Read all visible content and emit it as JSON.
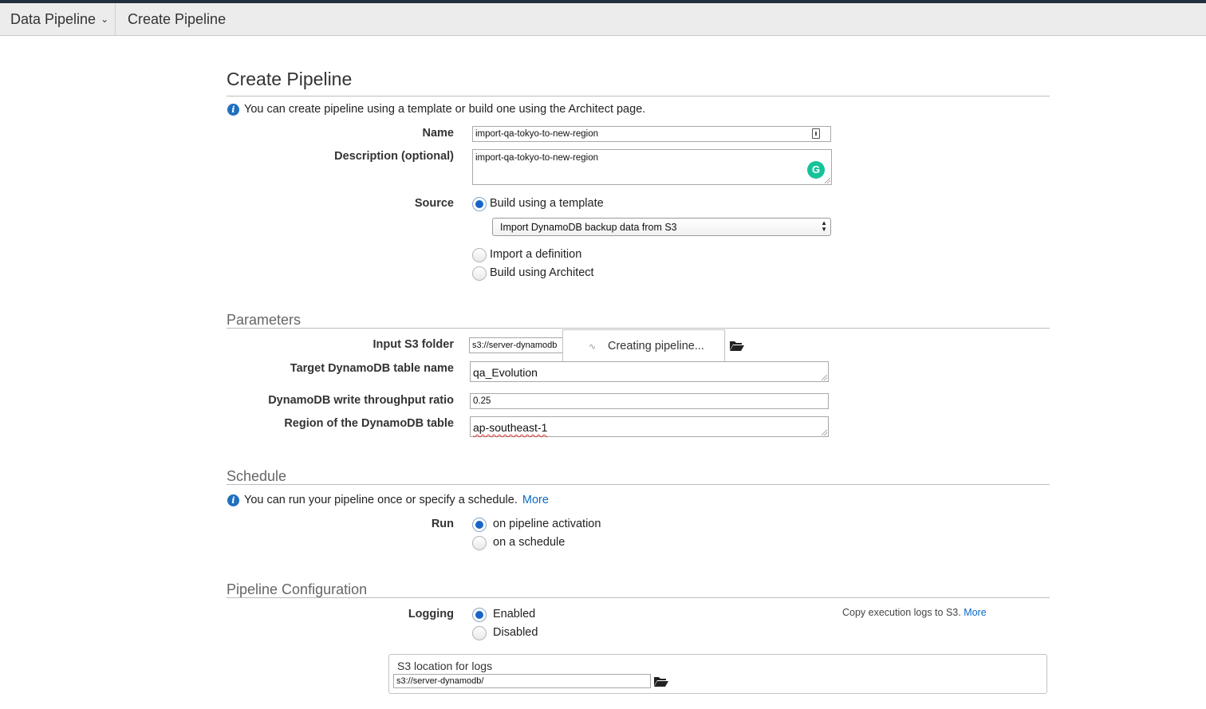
{
  "nav": {
    "service_label": "Data Pipeline",
    "page_label": "Create Pipeline"
  },
  "page": {
    "title": "Create Pipeline",
    "intro": "You can create pipeline using a template or build one using the Architect page."
  },
  "form": {
    "name_label": "Name",
    "name_value": "import-qa-tokyo-to-new-region",
    "description_label": "Description (optional)",
    "description_value": "import-qa-tokyo-to-new-region",
    "source_label": "Source",
    "source_options": {
      "template": "Build using a template",
      "import": "Import a definition",
      "architect": "Build using Architect"
    },
    "source_selected": "template",
    "template_select_value": "Import DynamoDB backup data from S3"
  },
  "parameters": {
    "heading": "Parameters",
    "input_s3_label": "Input S3 folder",
    "input_s3_value": "s3://server-dynamodb",
    "target_table_label": "Target DynamoDB table name",
    "target_table_value": "qa_Evolution",
    "throughput_label": "DynamoDB write throughput ratio",
    "throughput_value": "0.25",
    "region_label": "Region of the DynamoDB table",
    "region_value": "ap-southeast-1"
  },
  "toast": {
    "message": "Creating pipeline..."
  },
  "schedule": {
    "heading": "Schedule",
    "info": "You can run your pipeline once or specify a schedule.",
    "more_link": "More",
    "run_label": "Run",
    "options": {
      "activation": "on pipeline activation",
      "schedule": "on a schedule"
    },
    "selected": "activation"
  },
  "config": {
    "heading": "Pipeline Configuration",
    "logging_label": "Logging",
    "options": {
      "enabled": "Enabled",
      "disabled": "Disabled"
    },
    "selected": "enabled",
    "logging_help": "Copy execution logs to S3.",
    "logging_more_link": "More",
    "s3_logs_label": "S3 location for logs",
    "s3_logs_value": "s3://server-dynamodb/"
  },
  "colors": {
    "accent": "#1766c7",
    "link": "#0a6bc7",
    "topbar": "#232f3e",
    "navbar": "#ececec"
  },
  "icons": [
    "info-icon",
    "folder-open-icon",
    "chevron-down-icon",
    "spinner-icon",
    "grammarly-icon",
    "resize-grip-icon",
    "select-arrows-icon",
    "password-manager-icon"
  ]
}
